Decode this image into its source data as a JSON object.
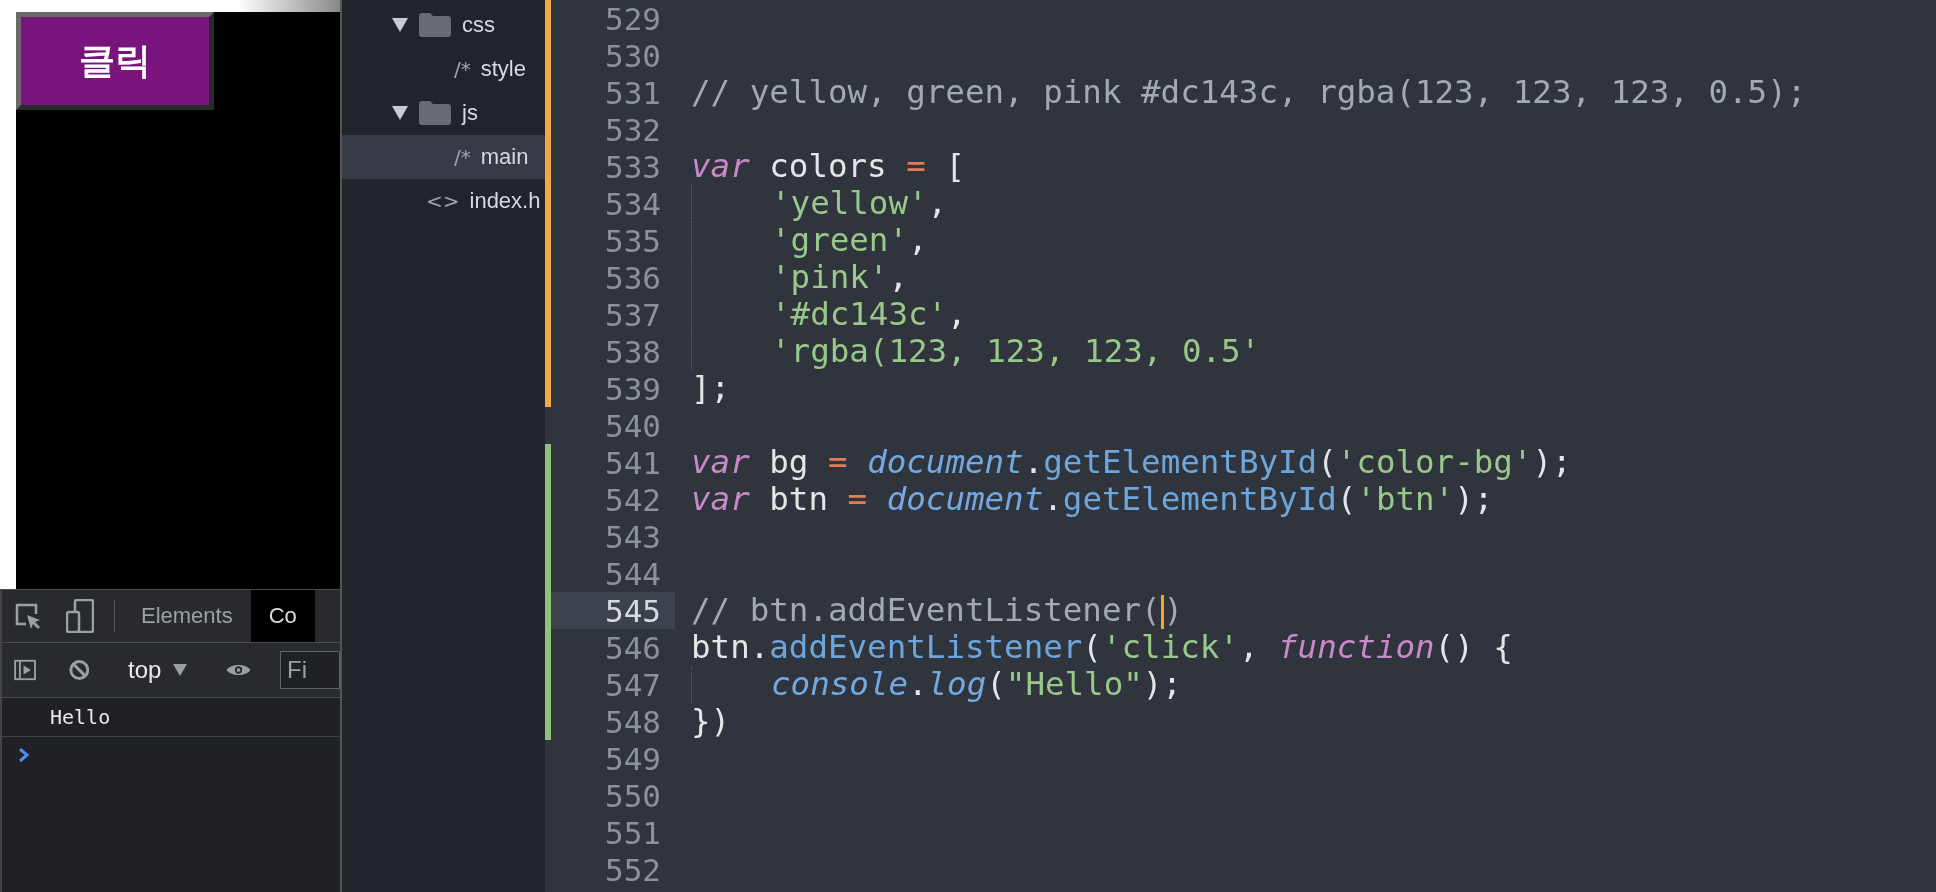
{
  "preview": {
    "button": {
      "label": "클릭"
    }
  },
  "devtools": {
    "tabs": [
      {
        "label": "Elements",
        "selected": false
      },
      {
        "label": "Co",
        "selected": true
      }
    ],
    "context": "top",
    "filter": {
      "placeholder": "Fi"
    },
    "console": [
      {
        "text": "Hello"
      }
    ]
  },
  "file_tree": [
    {
      "name": "css",
      "kind": "folder",
      "expanded": true,
      "selected": false,
      "children": [
        {
          "name": "style",
          "kind": "file",
          "icon": "/*",
          "selected": false
        }
      ]
    },
    {
      "name": "js",
      "kind": "folder",
      "expanded": true,
      "selected": false,
      "children": [
        {
          "name": "main",
          "kind": "file",
          "icon": "/*",
          "selected": true
        }
      ]
    },
    {
      "name": "index.h",
      "kind": "file",
      "icon": "<>",
      "selected": false
    }
  ],
  "editor": {
    "lines": [
      {
        "number": "529",
        "color": "#f0a848",
        "current": false
      },
      {
        "number": "530",
        "color": "#f0a848",
        "current": false
      },
      {
        "number": "531",
        "color": "#f0a848",
        "current": false,
        "tokens": [
          {
            "kind": "comment",
            "text": "// yellow, green, pink #dc143c, rgba(123, 123, 123, 0.5);"
          }
        ]
      },
      {
        "number": "532",
        "color": "#f0a848",
        "current": false
      },
      {
        "number": "533",
        "color": "#f0a848",
        "current": false,
        "tokens": [
          {
            "kind": "keyword",
            "text": "var"
          },
          {
            "kind": "plain",
            "text": " colors "
          },
          {
            "kind": "operator",
            "text": "="
          },
          {
            "kind": "plain",
            "text": " ["
          }
        ]
      },
      {
        "number": "534",
        "color": "#f0a848",
        "current": false,
        "indented": true,
        "tokens": [
          {
            "kind": "string",
            "text": "'yellow'"
          },
          {
            "kind": "plain",
            "text": ","
          }
        ]
      },
      {
        "number": "535",
        "color": "#f0a848",
        "current": false,
        "indented": true,
        "tokens": [
          {
            "kind": "string",
            "text": "'green'"
          },
          {
            "kind": "plain",
            "text": ","
          }
        ]
      },
      {
        "number": "536",
        "color": "#f0a848",
        "current": false,
        "indented": true,
        "tokens": [
          {
            "kind": "string",
            "text": "'pink'"
          },
          {
            "kind": "plain",
            "text": ","
          }
        ]
      },
      {
        "number": "537",
        "color": "#f0a848",
        "current": false,
        "indented": true,
        "tokens": [
          {
            "kind": "string",
            "text": "'#dc143c'"
          },
          {
            "kind": "plain",
            "text": ","
          }
        ]
      },
      {
        "number": "538",
        "color": "#f0a848",
        "current": false,
        "indented": true,
        "tokens": [
          {
            "kind": "string",
            "text": "'rgba(123, 123, 123, 0.5'"
          }
        ]
      },
      {
        "number": "539",
        "color": "#f0a848",
        "current": false,
        "tokens": [
          {
            "kind": "plain",
            "text": "];"
          }
        ]
      },
      {
        "number": "540",
        "current": false
      },
      {
        "number": "541",
        "color": "#8fc27e",
        "current": false,
        "tokens": [
          {
            "kind": "keyword",
            "text": "var"
          },
          {
            "kind": "plain",
            "text": " bg "
          },
          {
            "kind": "operator",
            "text": "= "
          },
          {
            "kind": "builtin",
            "text": "document"
          },
          {
            "kind": "plain",
            "text": "."
          },
          {
            "kind": "method",
            "text": "getElementById"
          },
          {
            "kind": "plain",
            "text": "("
          },
          {
            "kind": "string",
            "text": "'color-bg'"
          },
          {
            "kind": "plain",
            "text": ");"
          }
        ]
      },
      {
        "number": "542",
        "color": "#8fc27e",
        "current": false,
        "tokens": [
          {
            "kind": "keyword",
            "text": "var"
          },
          {
            "kind": "plain",
            "text": " btn "
          },
          {
            "kind": "operator",
            "text": "= "
          },
          {
            "kind": "builtin",
            "text": "document"
          },
          {
            "kind": "plain",
            "text": "."
          },
          {
            "kind": "method",
            "text": "getElementById"
          },
          {
            "kind": "plain",
            "text": "("
          },
          {
            "kind": "string",
            "text": "'btn'"
          },
          {
            "kind": "plain",
            "text": ");"
          }
        ]
      },
      {
        "number": "543",
        "color": "#8fc27e",
        "current": false
      },
      {
        "number": "544",
        "color": "#8fc27e",
        "current": false
      },
      {
        "number": "545",
        "color": "#8fc27e",
        "current": true,
        "tokens": [
          {
            "kind": "comment",
            "text": "// btn.addEventListener(",
            "cursor": true
          },
          {
            "kind": "comment",
            "text": ")"
          }
        ]
      },
      {
        "number": "546",
        "color": "#8fc27e",
        "current": false,
        "tokens": [
          {
            "kind": "plain",
            "text": "btn."
          },
          {
            "kind": "method",
            "text": "addEventListener"
          },
          {
            "kind": "plain",
            "text": "("
          },
          {
            "kind": "string",
            "text": "'click'"
          },
          {
            "kind": "plain",
            "text": ", "
          },
          {
            "kind": "keyword",
            "text": "function"
          },
          {
            "kind": "plain",
            "text": "() {"
          }
        ]
      },
      {
        "number": "547",
        "color": "#8fc27e",
        "current": false,
        "indented": true,
        "tokens": [
          {
            "kind": "builtin",
            "text": "console"
          },
          {
            "kind": "plain",
            "text": "."
          },
          {
            "kind": "builtin",
            "text": "log"
          },
          {
            "kind": "plain",
            "text": "("
          },
          {
            "kind": "string",
            "text": "\"Hello\""
          },
          {
            "kind": "plain",
            "text": ");"
          }
        ]
      },
      {
        "number": "548",
        "color": "#8fc27e",
        "current": false,
        "tokens": [
          {
            "kind": "plain",
            "text": "})"
          }
        ]
      },
      {
        "number": "549",
        "current": false
      },
      {
        "number": "550",
        "current": false
      },
      {
        "number": "551",
        "current": false
      },
      {
        "number": "552",
        "current": false
      }
    ]
  }
}
